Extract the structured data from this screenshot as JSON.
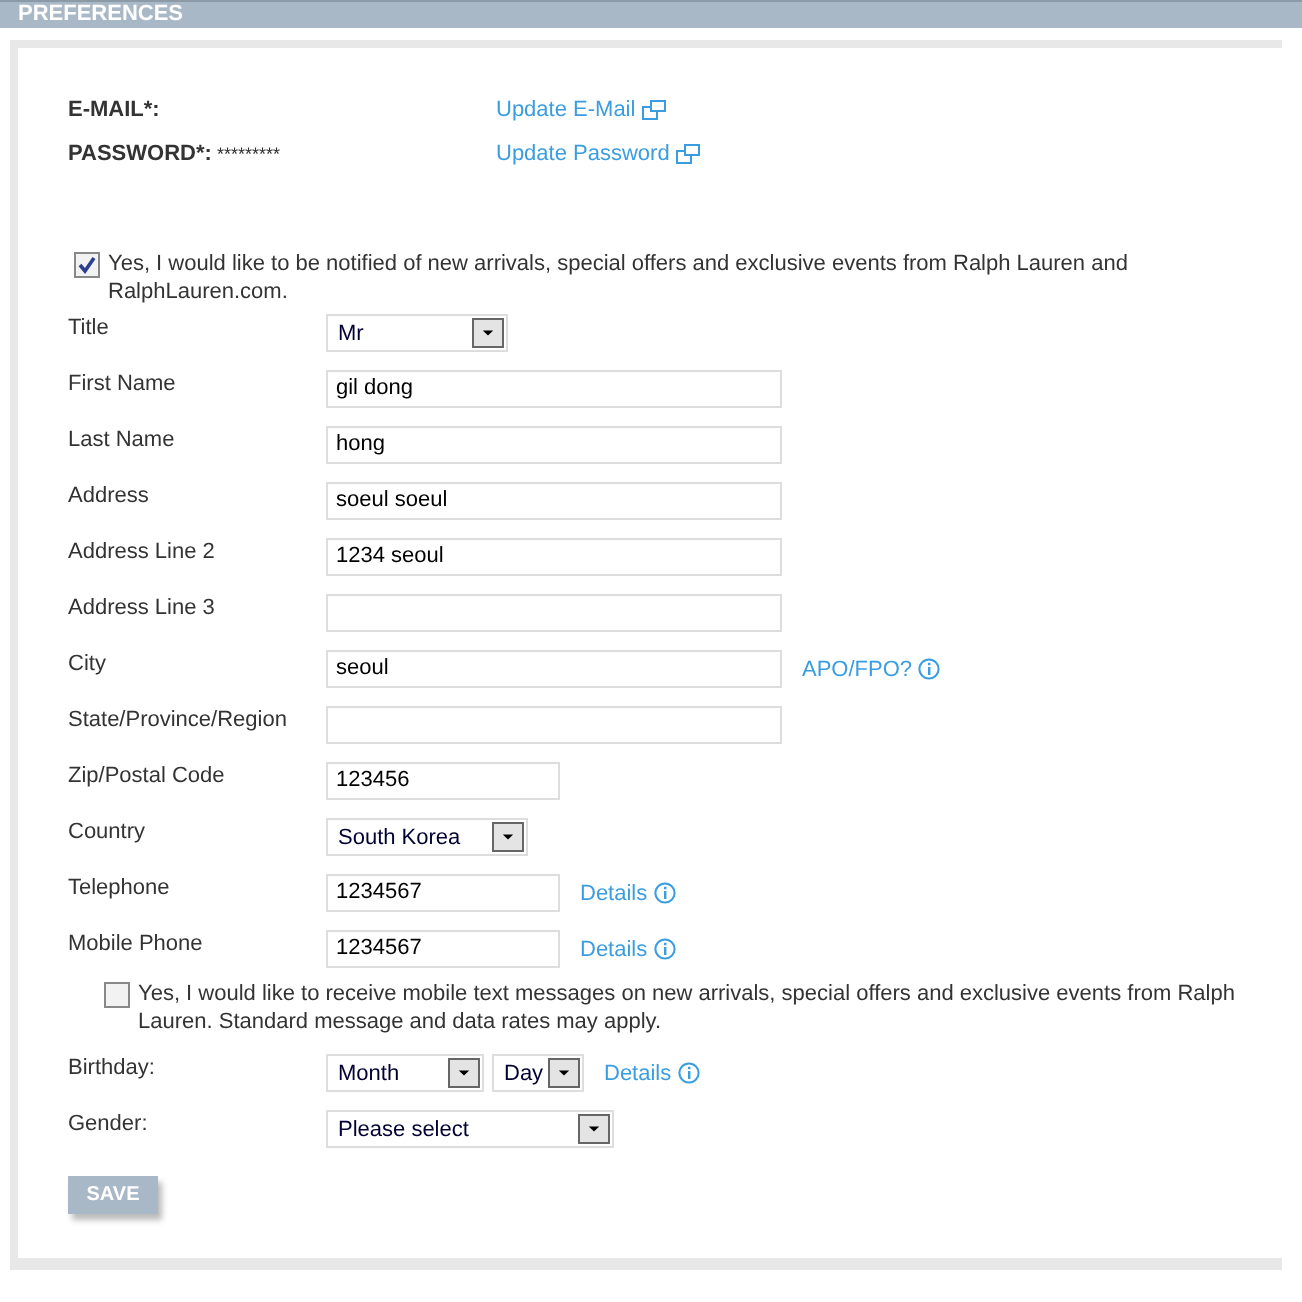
{
  "header": {
    "title": "PREFERENCES"
  },
  "account": [
    {
      "label": "E-MAIL*:",
      "link": "Update E-Mail"
    },
    {
      "label": "PASSWORD*:",
      "value": "*********",
      "link": "Update Password"
    }
  ],
  "newsletter": {
    "checked": true,
    "text": "Yes, I would like to be notified of new arrivals, special offers and exclusive events from Ralph Lauren and RalphLauren.com."
  },
  "fields": [
    {
      "label": "Title",
      "controls": [
        {
          "kind": "select",
          "value": "Mr"
        }
      ]
    },
    {
      "label": "First Name",
      "controls": [
        {
          "kind": "text",
          "value": "gil dong"
        }
      ]
    },
    {
      "label": "Last Name",
      "controls": [
        {
          "kind": "text",
          "value": "hong"
        }
      ]
    },
    {
      "label": "Address",
      "controls": [
        {
          "kind": "text",
          "value": "soeul soeul"
        }
      ]
    },
    {
      "label": "Address Line 2",
      "controls": [
        {
          "kind": "text",
          "value": "1234 seoul"
        }
      ]
    },
    {
      "label": "Address Line 3",
      "controls": [
        {
          "kind": "text"
        }
      ]
    },
    {
      "label": "City",
      "controls": [
        {
          "kind": "text",
          "value": "seoul"
        }
      ],
      "link": "APO/FPO?"
    },
    {
      "label": "State/Province/Region",
      "controls": [
        {
          "kind": "text"
        }
      ]
    },
    {
      "label": "Zip/Postal Code",
      "controls": [
        {
          "kind": "text",
          "value": "123456"
        }
      ]
    },
    {
      "label": "Country",
      "controls": [
        {
          "kind": "select",
          "value": "South Korea"
        }
      ]
    },
    {
      "label": "Telephone",
      "controls": [
        {
          "kind": "text",
          "value": "1234567"
        }
      ],
      "link": "Details"
    },
    {
      "label": "Mobile Phone",
      "controls": [
        {
          "kind": "text",
          "value": "1234567"
        }
      ],
      "link": "Details"
    }
  ],
  "sms": {
    "checked": false,
    "text": "Yes, I would like to receive mobile text messages on new arrivals, special offers and exclusive events from Ralph Lauren. Standard message and data rates may apply."
  },
  "more_fields": [
    {
      "label": "Birthday:",
      "controls": [
        {
          "kind": "select",
          "value": "Month"
        },
        {
          "kind": "select",
          "value": "Day"
        }
      ],
      "link": "Details"
    },
    {
      "label": "Gender:",
      "controls": [
        {
          "kind": "select",
          "value": "Please select"
        }
      ]
    }
  ],
  "save_button": "SAVE"
}
